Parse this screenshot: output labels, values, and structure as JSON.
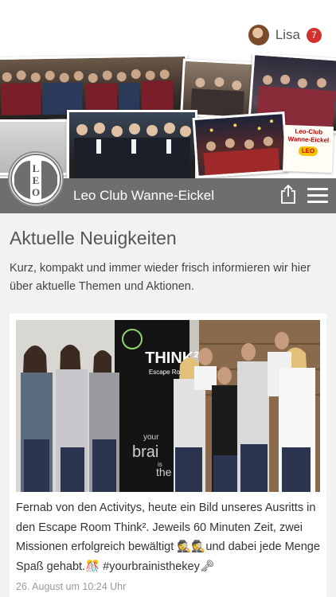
{
  "user": {
    "name": "Lisa",
    "notification_count": "7"
  },
  "banner": {
    "sticker_line1": "Leo-Club",
    "sticker_line2": "Wanne-Eickel",
    "sticker_leo": "LEO"
  },
  "club": {
    "name": "Leo Club Wanne-Eickel",
    "logo_text": "LEO"
  },
  "section": {
    "title": "Aktuelle Neuigkeiten",
    "intro": "Kurz, kompakt und immer wieder frisch informieren wir hier über aktuelle Themen und Aktionen."
  },
  "post": {
    "photo_sign_title": "THINK²",
    "photo_sign_subtitle": "Escape Room",
    "photo_banner_text1": "your",
    "photo_banner_text2": "brai",
    "photo_banner_text3": "is",
    "photo_banner_text4": "the ke",
    "text": "Fernab von den Activitys, heute ein Bild unseres Ausritts in den Escape Room Think². Jeweils 60 Minuten Zeit, zwei Missionen erfolgreich bewältigt 🕵🕵und dabei jede Menge Spaß gehabt.🎊 #yourbrainisthekey🗝",
    "date": "26. August um 10:24 Uhr"
  },
  "colors": {
    "club_bar": "#6e6e6e",
    "badge": "#d32f2f",
    "background": "#f2f2f2"
  }
}
